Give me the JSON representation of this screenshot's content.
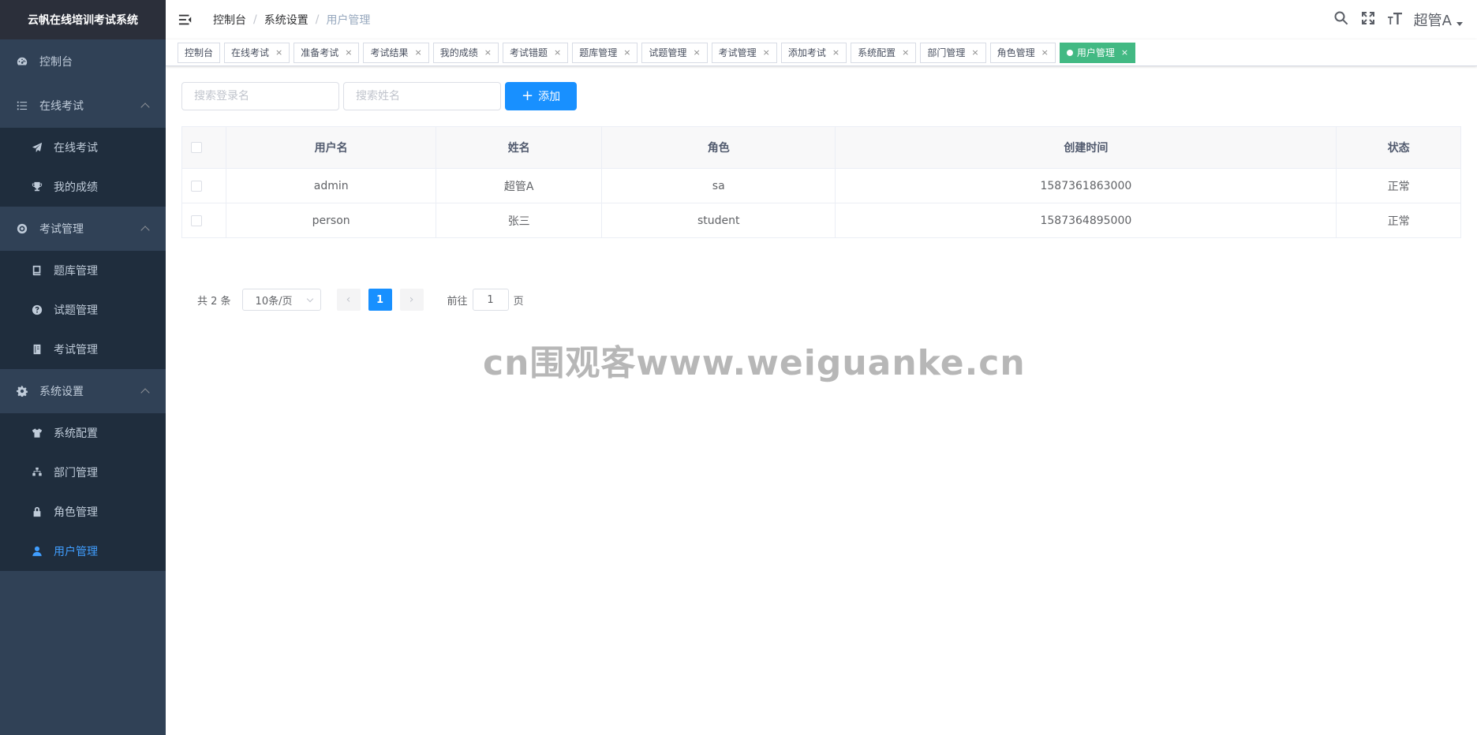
{
  "sidebar": {
    "logo": "云帆在线培训考试系统",
    "items": [
      {
        "label": "控制台",
        "icon": "dashboard-icon"
      },
      {
        "label": "在线考试",
        "icon": "list-icon",
        "expanded": true,
        "children": [
          {
            "label": "在线考试",
            "icon": "paper-plane-icon"
          },
          {
            "label": "我的成绩",
            "icon": "trophy-icon"
          }
        ]
      },
      {
        "label": "考试管理",
        "icon": "lifebuoy-icon",
        "expanded": true,
        "children": [
          {
            "label": "题库管理",
            "icon": "book-icon"
          },
          {
            "label": "试题管理",
            "icon": "question-circle-icon"
          },
          {
            "label": "考试管理",
            "icon": "notebook-icon"
          }
        ]
      },
      {
        "label": "系统设置",
        "icon": "gear-icon",
        "expanded": true,
        "children": [
          {
            "label": "系统配置",
            "icon": "shirt-icon"
          },
          {
            "label": "部门管理",
            "icon": "sitemap-icon"
          },
          {
            "label": "角色管理",
            "icon": "lock-icon"
          },
          {
            "label": "用户管理",
            "icon": "user-icon",
            "active": true
          }
        ]
      }
    ]
  },
  "navbar": {
    "breadcrumb": [
      "控制台",
      "系统设置",
      "用户管理"
    ],
    "user": "超管A"
  },
  "tags": [
    {
      "label": "控制台",
      "closable": false
    },
    {
      "label": "在线考试",
      "closable": true
    },
    {
      "label": "准备考试",
      "closable": true
    },
    {
      "label": "考试结果",
      "closable": true
    },
    {
      "label": "我的成绩",
      "closable": true
    },
    {
      "label": "考试错题",
      "closable": true
    },
    {
      "label": "题库管理",
      "closable": true
    },
    {
      "label": "试题管理",
      "closable": true
    },
    {
      "label": "考试管理",
      "closable": true
    },
    {
      "label": "添加考试",
      "closable": true
    },
    {
      "label": "系统配置",
      "closable": true
    },
    {
      "label": "部门管理",
      "closable": true
    },
    {
      "label": "角色管理",
      "closable": true
    },
    {
      "label": "用户管理",
      "closable": true,
      "active": true
    }
  ],
  "filters": {
    "login_placeholder": "搜索登录名",
    "name_placeholder": "搜索姓名",
    "add_label": "添加"
  },
  "table": {
    "headers": [
      "用户名",
      "姓名",
      "角色",
      "创建时间",
      "状态"
    ],
    "rows": [
      [
        "admin",
        "超管A",
        "sa",
        "1587361863000",
        "正常"
      ],
      [
        "person",
        "张三",
        "student",
        "1587364895000",
        "正常"
      ]
    ]
  },
  "pagination": {
    "total": "共 2 条",
    "page_size": "10条/页",
    "current_page": "1",
    "goto_prefix": "前往",
    "goto_value": "1",
    "goto_suffix": "页"
  },
  "watermark": "cn围观客www.weiguanke.cn",
  "colors": {
    "sidebar_bg": "#304156",
    "submenu_bg": "#1f2d3d",
    "primary": "#1890ff",
    "active_tag": "#42b983"
  }
}
